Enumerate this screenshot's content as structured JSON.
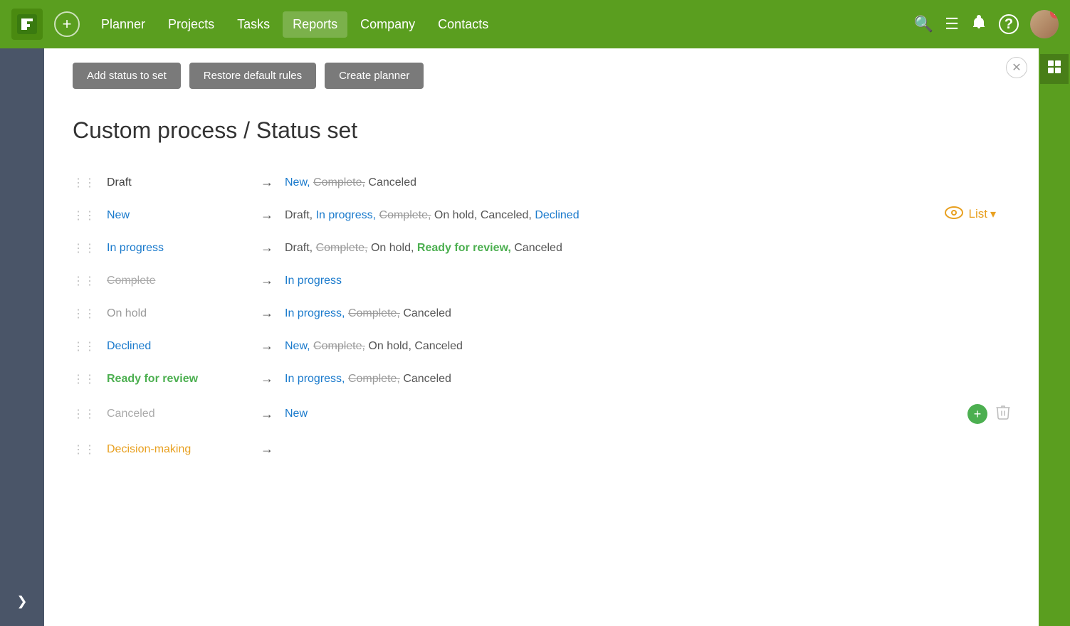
{
  "nav": {
    "logo": "P",
    "add_btn": "+",
    "links": [
      {
        "label": "Planner",
        "active": false
      },
      {
        "label": "Projects",
        "active": false
      },
      {
        "label": "Tasks",
        "active": false
      },
      {
        "label": "Reports",
        "active": true
      },
      {
        "label": "Company",
        "active": false
      },
      {
        "label": "Contacts",
        "active": false
      }
    ]
  },
  "toolbar": {
    "add_status_label": "Add status to set",
    "restore_label": "Restore default rules",
    "create_planner_label": "Create planner"
  },
  "page": {
    "title": "Custom process / Status set",
    "view_label": "List"
  },
  "statuses": [
    {
      "name": "Draft",
      "name_color": "draft",
      "targets": [
        {
          "text": "New,",
          "color": "blue"
        },
        {
          "text": "Complete,",
          "color": "strikethrough"
        },
        {
          "text": "Canceled",
          "color": "dark"
        }
      ]
    },
    {
      "name": "New",
      "name_color": "blue",
      "targets": [
        {
          "text": "Draft,",
          "color": "dark"
        },
        {
          "text": "In progress,",
          "color": "blue"
        },
        {
          "text": "Complete,",
          "color": "strikethrough"
        },
        {
          "text": "On hold,",
          "color": "dark"
        },
        {
          "text": "Canceled,",
          "color": "dark"
        },
        {
          "text": "Declined",
          "color": "blue"
        }
      ]
    },
    {
      "name": "In progress",
      "name_color": "blue",
      "targets": [
        {
          "text": "Draft,",
          "color": "dark"
        },
        {
          "text": "Complete,",
          "color": "strikethrough"
        },
        {
          "text": "On hold,",
          "color": "dark"
        },
        {
          "text": "Ready for review,",
          "color": "green"
        },
        {
          "text": "Canceled",
          "color": "dark"
        }
      ]
    },
    {
      "name": "Complete",
      "name_color": "strikethrough",
      "targets": [
        {
          "text": "In progress",
          "color": "blue"
        }
      ]
    },
    {
      "name": "On hold",
      "name_color": "gray",
      "targets": [
        {
          "text": "In progress,",
          "color": "blue"
        },
        {
          "text": "Complete,",
          "color": "strikethrough"
        },
        {
          "text": "Canceled",
          "color": "dark"
        }
      ]
    },
    {
      "name": "Declined",
      "name_color": "blue",
      "targets": [
        {
          "text": "New,",
          "color": "blue"
        },
        {
          "text": "Complete,",
          "color": "strikethrough"
        },
        {
          "text": "On hold,",
          "color": "dark"
        },
        {
          "text": "Canceled",
          "color": "dark"
        }
      ]
    },
    {
      "name": "Ready for review",
      "name_color": "green",
      "targets": [
        {
          "text": "In progress,",
          "color": "blue"
        },
        {
          "text": "Complete,",
          "color": "strikethrough"
        },
        {
          "text": "Canceled",
          "color": "dark"
        }
      ]
    },
    {
      "name": "Canceled",
      "name_color": "gray-plain",
      "targets": [
        {
          "text": "New",
          "color": "blue"
        }
      ],
      "show_actions": true
    },
    {
      "name": "Decision-making",
      "name_color": "orange",
      "targets": []
    }
  ],
  "icons": {
    "drag": "⋮⋮",
    "arrow": "→",
    "close": "✕",
    "add": "+",
    "delete": "🗑",
    "eye": "👁",
    "chevron_down": "▾",
    "chevron_right": "❯",
    "search": "🔍",
    "menu": "☰",
    "bell": "🔔",
    "help": "?",
    "sidebar_widget": "📋"
  }
}
